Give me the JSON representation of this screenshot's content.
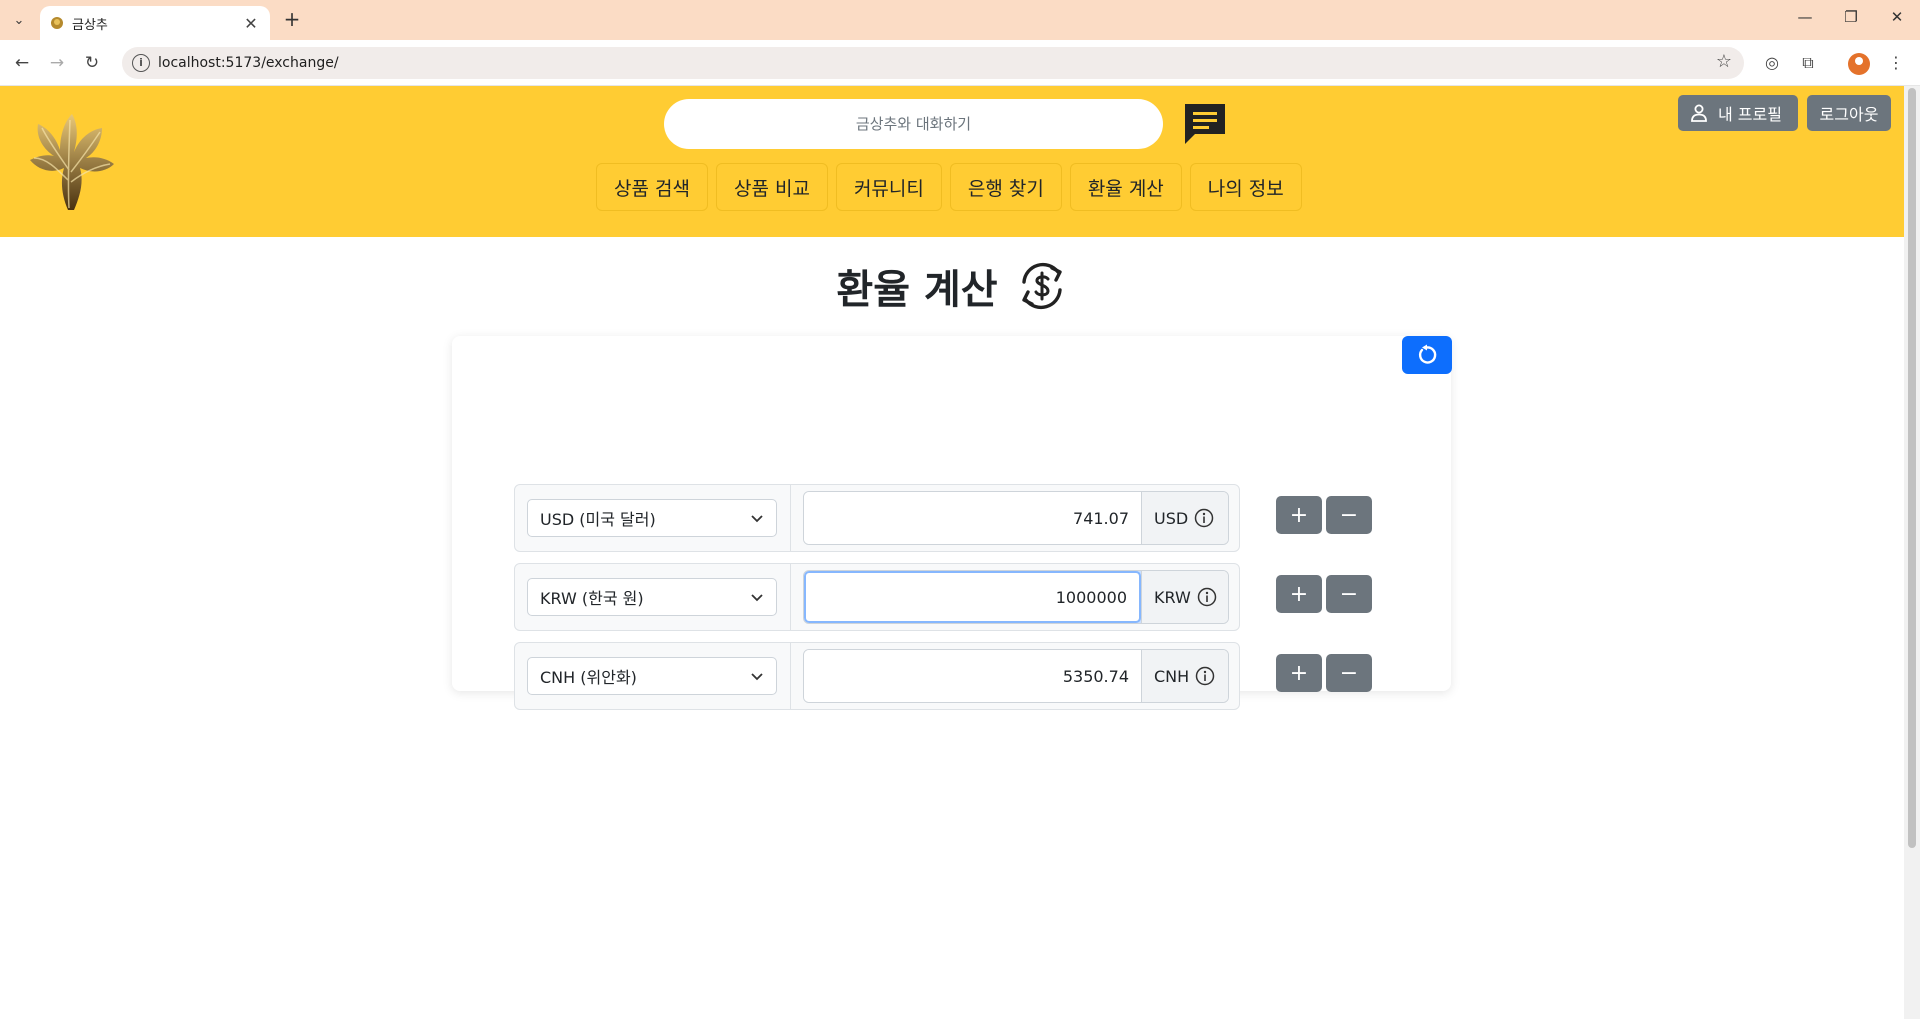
{
  "browser": {
    "tab_title": "금상추",
    "url": "localhost:5173/exchange/",
    "new_tab_symbol": "+",
    "close_symbol": "✕"
  },
  "header": {
    "chat_placeholder": "금상추와 대화하기",
    "nav_items": [
      "상품 검색",
      "상품 비교",
      "커뮤니티",
      "은행 찾기",
      "환율 계산",
      "나의 정보"
    ],
    "profile_label": "내 프로필",
    "logout_label": "로그아웃"
  },
  "main": {
    "title": "환율 계산",
    "rows": [
      {
        "currency_label": "USD (미국 달러)",
        "amount": "741.07",
        "code": "USD",
        "focused": false
      },
      {
        "currency_label": "KRW (한국 원)",
        "amount": "1000000",
        "code": "KRW",
        "focused": true
      },
      {
        "currency_label": "CNH (위안화)",
        "amount": "5350.74",
        "code": "CNH",
        "focused": false
      }
    ],
    "plus_label": "+",
    "minus_label": "−"
  },
  "colors": {
    "header_bg": "#ffcc33",
    "primary": "#0d6efd",
    "secondary": "#6c757d"
  },
  "icons": [
    "lettuce-logo-icon",
    "chat-bubble-icon",
    "person-icon",
    "exchange-dollar-icon",
    "reset-icon",
    "chevron-down-icon",
    "info-icon"
  ]
}
